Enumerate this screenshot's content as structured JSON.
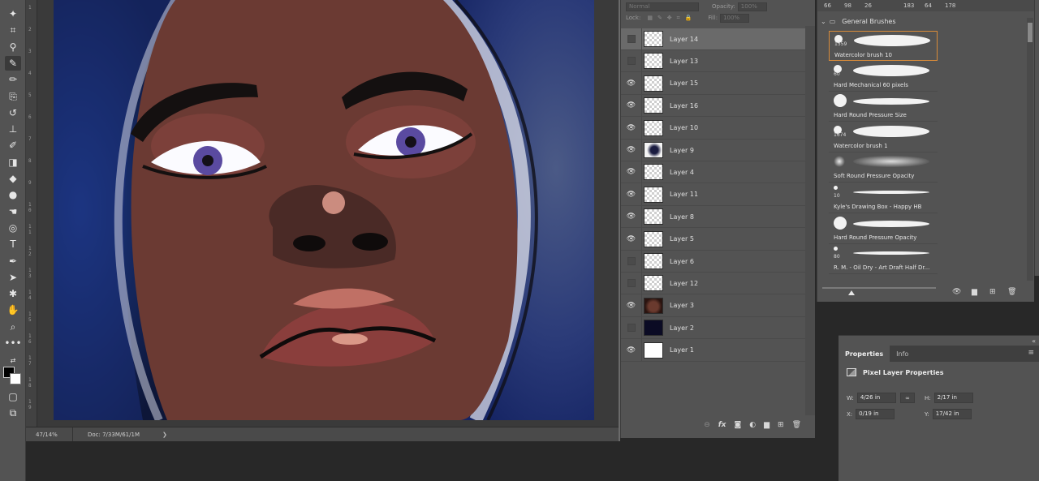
{
  "colors": {
    "toolbar_bg": "#535353",
    "app_bg": "#282828",
    "panel_bg": "#535353",
    "selected_row": "#6a6a6a",
    "brush_selected_border": "#d88b3a"
  },
  "toolbar": {
    "tools": [
      "magic-wand-icon",
      "crop-icon",
      "eyedropper-icon",
      "brush-icon",
      "pencil-icon",
      "clone-icon",
      "history-brush-icon",
      "stamp-icon",
      "smudge-brush-icon",
      "eraser-icon",
      "paint-bucket-icon",
      "blur-drop-icon",
      "smudge-icon",
      "sponge-icon",
      "type-icon",
      "pen-icon",
      "path-select-icon",
      "custom-shape-icon",
      "hand-icon",
      "zoom-icon",
      "more-tools-icon"
    ],
    "active_tool": "brush-icon",
    "more_label": "•••",
    "type_label": "T"
  },
  "ruler": {
    "marks": [
      "1",
      "2",
      "3",
      "4",
      "5",
      "6",
      "7",
      "8",
      "9",
      "1 0",
      "1 1",
      "1 2",
      "1 3",
      "1 4",
      "1 5",
      "1 6",
      "1 7",
      "1 8",
      "1 9"
    ]
  },
  "status_bar": {
    "zoom": "47/14%",
    "doc": "Doc: 7/33M/61/1M",
    "arrow": "❯"
  },
  "layers_panel": {
    "top": {
      "blend_mode": "Normal",
      "opacity_label": "Opacity:",
      "lock_label": "Lock:",
      "fill_label": "Fill:",
      "fill_value": "100%",
      "opacity_value": "100%"
    },
    "layers": [
      {
        "name": "Layer 14",
        "visible": false,
        "selected": true,
        "thumb": "checker"
      },
      {
        "name": "Layer 13",
        "visible": false,
        "selected": false,
        "thumb": "checker"
      },
      {
        "name": "Layer 15",
        "visible": true,
        "selected": false,
        "thumb": "checker"
      },
      {
        "name": "Layer 16",
        "visible": true,
        "selected": false,
        "thumb": "checker"
      },
      {
        "name": "Layer 10",
        "visible": true,
        "selected": false,
        "thumb": "checker"
      },
      {
        "name": "Layer 9",
        "visible": true,
        "selected": false,
        "thumb": "hair"
      },
      {
        "name": "Layer 4",
        "visible": true,
        "selected": false,
        "thumb": "checker"
      },
      {
        "name": "Layer 11",
        "visible": true,
        "selected": false,
        "thumb": "checker"
      },
      {
        "name": "Layer 8",
        "visible": true,
        "selected": false,
        "thumb": "checker"
      },
      {
        "name": "Layer 5",
        "visible": true,
        "selected": false,
        "thumb": "checker"
      },
      {
        "name": "Layer 6",
        "visible": false,
        "selected": false,
        "thumb": "checker"
      },
      {
        "name": "Layer 12",
        "visible": false,
        "selected": false,
        "thumb": "checker"
      },
      {
        "name": "Layer 3",
        "visible": true,
        "selected": false,
        "thumb": "face"
      },
      {
        "name": "Layer 2",
        "visible": false,
        "selected": false,
        "thumb": "dark"
      },
      {
        "name": "Layer 1",
        "visible": true,
        "selected": false,
        "thumb": "white"
      }
    ],
    "bottom_icons": [
      "link-icon",
      "fx-icon",
      "mask-icon",
      "adjustment-icon",
      "folder-icon",
      "new-layer-icon",
      "trash-icon"
    ],
    "fx_label": "fx"
  },
  "brushes_panel": {
    "sizes": [
      "66",
      "98",
      "26",
      "183",
      "64",
      "178"
    ],
    "folder_label": "General Brushes",
    "brushes": [
      {
        "num": "1559",
        "name": "Watercolor brush 10",
        "selected": true,
        "kind": "stroke"
      },
      {
        "num": "60",
        "name": "Hard Mechanical 60 pixels",
        "selected": false,
        "kind": "stroke"
      },
      {
        "num": "",
        "name": "Hard Round Pressure Size",
        "selected": false,
        "kind": "dot-stroke"
      },
      {
        "num": "1674",
        "name": "Watercolor brush 1",
        "selected": false,
        "kind": "stroke"
      },
      {
        "num": "",
        "name": "Soft Round Pressure Opacity",
        "selected": false,
        "kind": "soft"
      },
      {
        "num": "10",
        "name": "Kyle's Drawing Box - Happy HB",
        "selected": false,
        "kind": "thin"
      },
      {
        "num": "",
        "name": "Hard Round Pressure Opacity",
        "selected": false,
        "kind": "dot-stroke"
      },
      {
        "num": "80",
        "name": "R. M. - Oil Dry - Art Draft Half Dr...",
        "selected": false,
        "kind": "thin"
      }
    ],
    "bottom_icons": [
      "eye-toggle-icon",
      "folder-icon",
      "new-brush-icon",
      "trash-icon"
    ]
  },
  "properties_panel": {
    "tabs": [
      {
        "label": "Properties",
        "active": true
      },
      {
        "label": "Info",
        "active": false
      }
    ],
    "heading": "Pixel Layer Properties",
    "fields": {
      "w_label": "W:",
      "w_value": "4/26 in",
      "h_label": "H:",
      "h_value": "2/17 in",
      "x_label": "X:",
      "x_value": "0/19 in",
      "y_label": "Y:",
      "y_value": "17/42 in"
    },
    "collapse": "«",
    "menu": "≡"
  }
}
